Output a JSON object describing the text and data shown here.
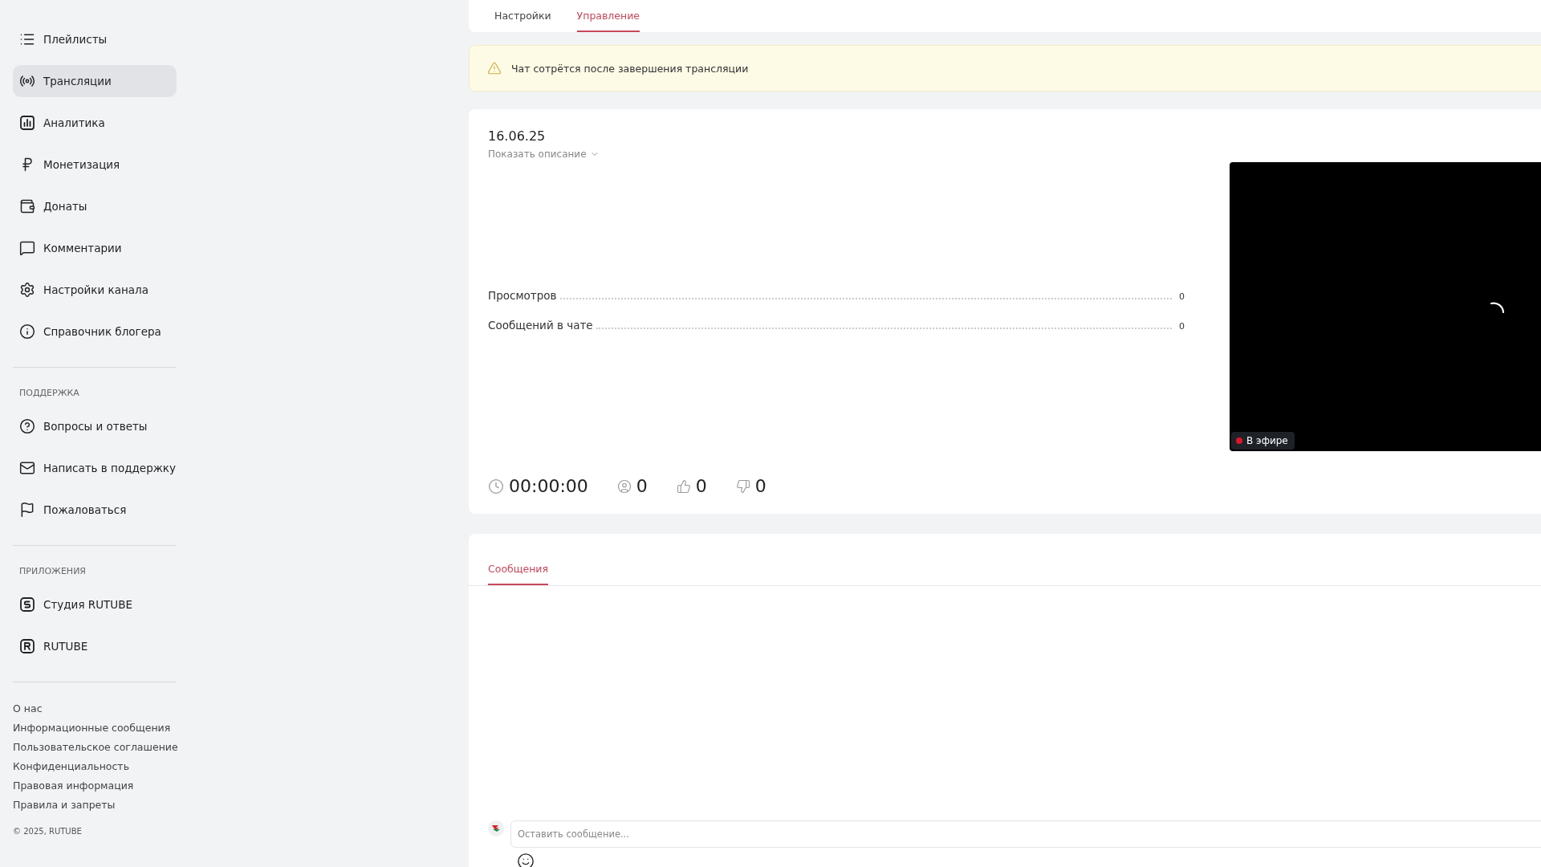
{
  "sidebar": {
    "main_items": [
      {
        "label": "Плейлисты",
        "selected": false
      },
      {
        "label": "Трансляции",
        "selected": true
      },
      {
        "label": "Аналитика",
        "selected": false
      },
      {
        "label": "Монетизация",
        "selected": false
      },
      {
        "label": "Донаты",
        "selected": false
      },
      {
        "label": "Комментарии",
        "selected": false
      },
      {
        "label": "Настройки канала",
        "selected": false
      },
      {
        "label": "Справочник блогера",
        "selected": false
      }
    ],
    "sections": [
      {
        "title": "ПОДДЕРЖКА",
        "items": [
          {
            "label": "Вопросы и ответы",
            "selected": false
          },
          {
            "label": "Написать в поддержку",
            "selected": false
          },
          {
            "label": "Пожаловаться",
            "selected": false
          }
        ]
      },
      {
        "title": "ПРИЛОЖЕНИЯ",
        "items": [
          {
            "label": "Студия RUTUBE",
            "selected": false
          },
          {
            "label": "RUTUBE",
            "selected": false
          }
        ]
      }
    ],
    "footer_links": [
      "О нас",
      "Информационные сообщения",
      "Пользовательское соглашение",
      "Конфиденциальность",
      "Правовая информация",
      "Правила и запреты"
    ],
    "copyright": "© 2025, RUTUBE"
  },
  "tabs": [
    {
      "label": "Настройки",
      "selected": false
    },
    {
      "label": "Управление",
      "selected": true
    }
  ],
  "alert": "Чат сотрётся после завершения трансляции",
  "stream": {
    "date": "16.06.25",
    "show_description": "Показать описание",
    "stats": [
      {
        "label": "Просмотров",
        "value": "0"
      },
      {
        "label": "Сообщений в чате",
        "value": "0"
      }
    ],
    "badge": "В эфире",
    "counters": [
      {
        "kind": "timer",
        "value": "00:00:00"
      },
      {
        "kind": "viewers",
        "value": "0"
      },
      {
        "kind": "likes",
        "value": "0"
      },
      {
        "kind": "dislikes",
        "value": "0"
      }
    ]
  },
  "chat": {
    "tabs": [
      {
        "label": "Сообщения",
        "selected": true
      }
    ],
    "input": {
      "placeholder": "Оставить сообщение..."
    }
  }
}
